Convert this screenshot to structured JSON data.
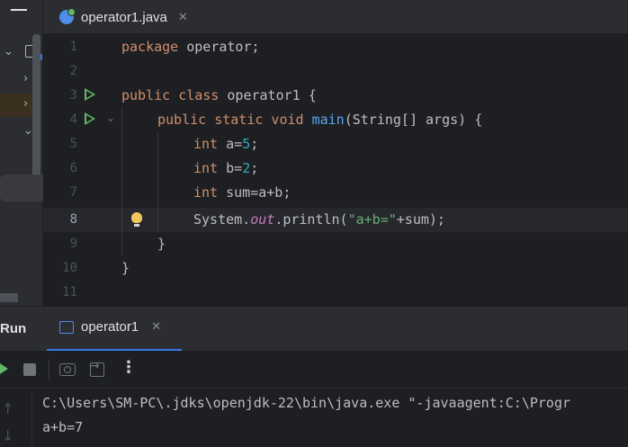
{
  "editor_tab": {
    "filename": "operator1.java",
    "close_glyph": "✕"
  },
  "code_lines": [
    {
      "num": "1"
    },
    {
      "num": "2"
    },
    {
      "num": "3"
    },
    {
      "num": "4"
    },
    {
      "num": "5"
    },
    {
      "num": "6"
    },
    {
      "num": "7"
    },
    {
      "num": "8"
    },
    {
      "num": "9"
    },
    {
      "num": "10"
    },
    {
      "num": "11"
    }
  ],
  "code": {
    "l1_kw": "package",
    "l1_rest": " operator;",
    "l3_kw": "public class",
    "l3_rest": " operator1 {",
    "l4_kw": "public static void",
    "l4_fn": "main",
    "l4_rest": "(String[] args) {",
    "l5_kw": "int",
    "l5_a": " a=",
    "l5_n": "5",
    "l5_end": ";",
    "l6_kw": "int",
    "l6_a": " b=",
    "l6_n": "2",
    "l6_end": ";",
    "l7_kw": "int",
    "l7_rest": " sum=a+b;",
    "l8_a": "System.",
    "l8_fld": "out",
    "l8_b": ".println(",
    "l8_str": "\"a+b=\"",
    "l8_c": "+sum);",
    "l9": "}",
    "l10": "}"
  },
  "run_panel": {
    "title": "Run",
    "tab_label": "operator1",
    "close_glyph": "✕",
    "more_glyph": "⋮"
  },
  "console": {
    "line1": "C:\\Users\\SM-PC\\.jdks\\openjdk-22\\bin\\java.exe \"-javaagent:C:\\Progr",
    "line2": "a+b=7",
    "up_glyph": "↑",
    "down_glyph": "↓"
  },
  "colors": {
    "background": "#1e1f22",
    "panel": "#2b2d30",
    "keyword": "#cf8e6d",
    "number": "#2aacb8",
    "function": "#56a8f5",
    "field": "#c77dbb",
    "string": "#6aab73",
    "accent": "#3574f0",
    "run_green": "#5fb865"
  },
  "icons": [
    "menu-icon",
    "folder-icon",
    "java-class-icon",
    "run-gutter-icon",
    "fold-icon",
    "lightbulb-icon",
    "console-icon",
    "rerun-icon",
    "stop-icon",
    "camera-icon",
    "exit-icon",
    "more-icon",
    "scroll-up-icon",
    "scroll-down-icon"
  ]
}
